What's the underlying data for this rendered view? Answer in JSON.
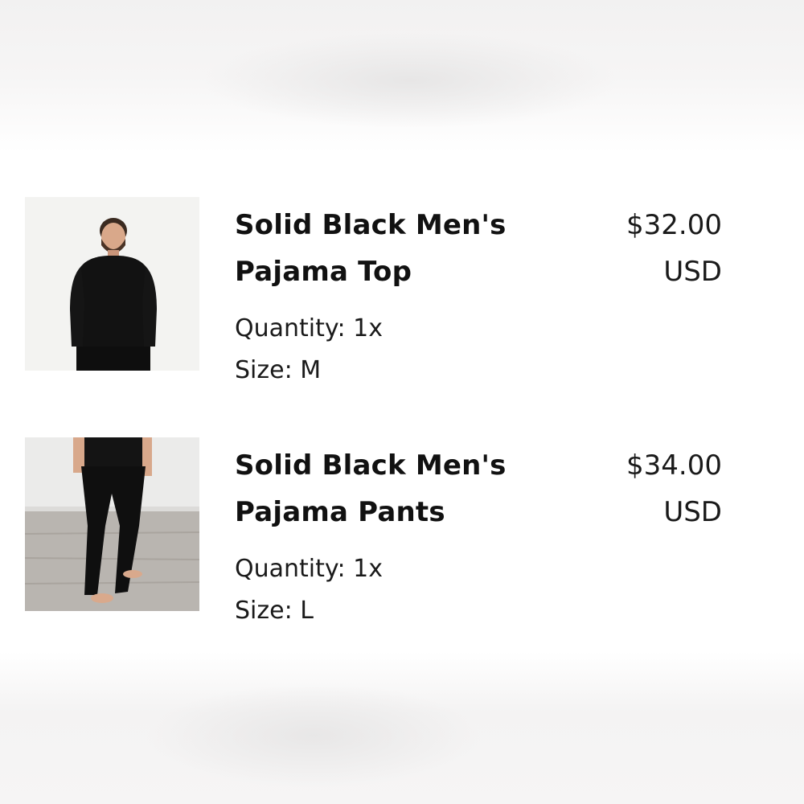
{
  "cart": {
    "items": [
      {
        "name": "Solid Black Men's Pajama Top",
        "price": "$32.00",
        "currency": "USD",
        "quantity_label": "Quantity:",
        "quantity": "1x",
        "size_label": "Size:",
        "size": "M"
      },
      {
        "name": "Solid Black Men's Pajama Pants",
        "price": "$34.00",
        "currency": "USD",
        "quantity_label": "Quantity:",
        "quantity": "1x",
        "size_label": "Size:",
        "size": "L"
      }
    ]
  },
  "colors": {
    "text": "#111111",
    "background": "#ffffff",
    "garment": "#111111"
  }
}
